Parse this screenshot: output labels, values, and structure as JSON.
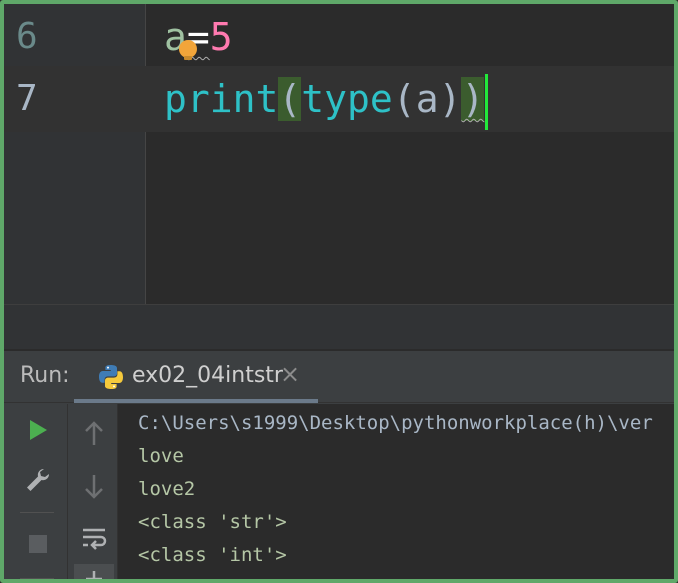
{
  "editor": {
    "lines": [
      {
        "number": "6",
        "tokens": {
          "var": "a",
          "op": "=",
          "num": "5"
        }
      },
      {
        "number": "7",
        "tokens": {
          "fn": "print",
          "open": "(",
          "inner_fn": "type",
          "inner_open": "(",
          "arg": "a",
          "inner_close": ")",
          "close": ")"
        }
      }
    ],
    "colors": {
      "caret": "#22e83a",
      "paren_highlight": "#3b5c2e",
      "function": "#2ec1c7",
      "number": "#ff7ab0",
      "intention_bulb": "#f2a53a"
    }
  },
  "run_panel": {
    "label": "Run:",
    "tab": {
      "title": "ex02_04intstr",
      "icon": "python-icon",
      "close": "×"
    },
    "toolbar": [
      "run-icon",
      "wrench-icon",
      "stop-icon",
      "up-arrow-icon",
      "down-arrow-icon",
      "soft-wrap-icon"
    ],
    "console": {
      "command": "C:\\Users\\s1999\\Desktop\\pythonworkplace(h)\\ver",
      "output": [
        "love",
        "love2",
        "<class 'str'>",
        "<class 'int'>"
      ]
    }
  }
}
